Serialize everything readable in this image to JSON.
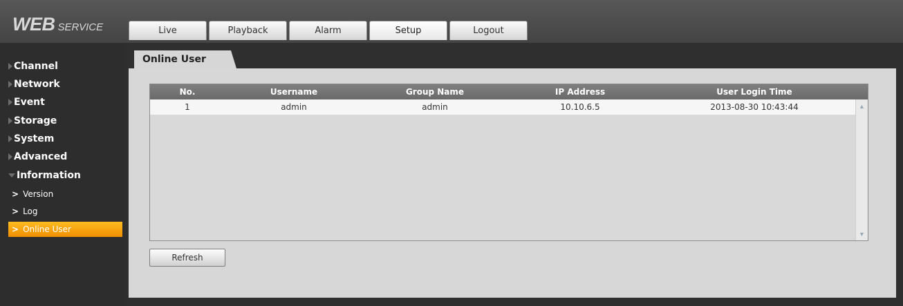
{
  "logo": {
    "main": "WEB",
    "sub": "SERVICE"
  },
  "nav": {
    "tabs": [
      "Live",
      "Playback",
      "Alarm",
      "Setup",
      "Logout"
    ],
    "active": "Setup"
  },
  "sidebar": {
    "items": [
      {
        "label": "Channel"
      },
      {
        "label": "Network"
      },
      {
        "label": "Event"
      },
      {
        "label": "Storage"
      },
      {
        "label": "System"
      },
      {
        "label": "Advanced"
      },
      {
        "label": "Information",
        "expanded": true
      }
    ],
    "subitems": [
      {
        "label": "Version"
      },
      {
        "label": "Log"
      },
      {
        "label": "Online User",
        "active": true
      }
    ]
  },
  "content": {
    "tab_label": "Online User",
    "table": {
      "headers": [
        "No.",
        "Username",
        "Group Name",
        "IP Address",
        "User Login Time"
      ],
      "rows": [
        [
          "1",
          "admin",
          "admin",
          "10.10.6.5",
          "2013-08-30 10:43:44"
        ]
      ]
    },
    "refresh_label": "Refresh"
  },
  "colors": {
    "accent": "#f5a000",
    "background": "#2f2f2f",
    "panel": "#d7d7d7"
  }
}
